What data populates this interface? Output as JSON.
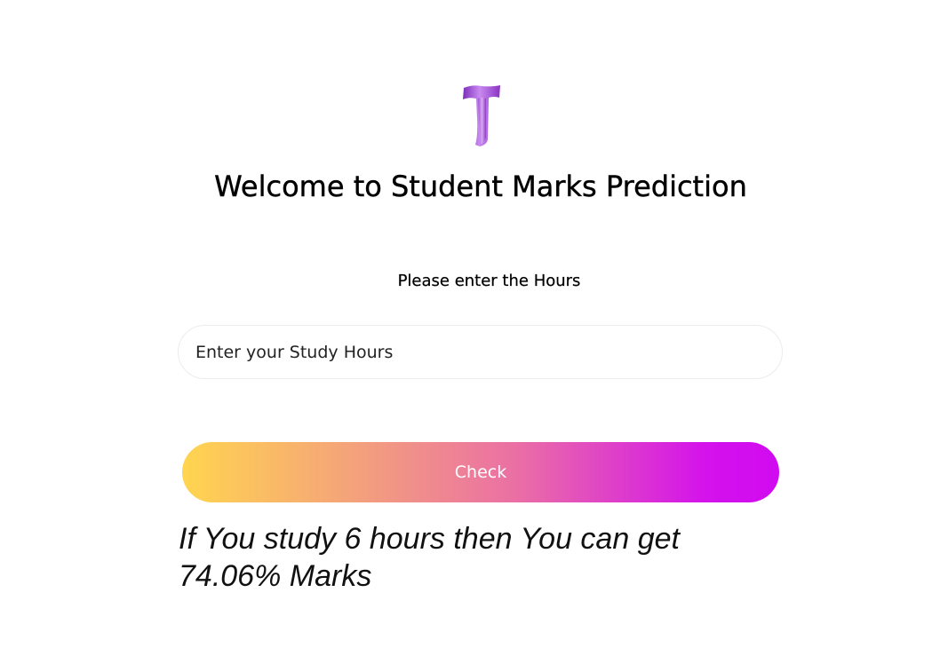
{
  "logo": {
    "letter": "T",
    "icon": "purple-t-logo-icon",
    "color": "#a24bd6"
  },
  "header": {
    "title": "Welcome to Student Marks Prediction"
  },
  "form": {
    "label": "Please enter the Hours",
    "input": {
      "placeholder": "Enter your Study Hours",
      "value": ""
    },
    "submit_label": "Check",
    "gradient_colors": [
      "#ffd54f",
      "#f4a37a",
      "#ea6fa5",
      "#d312ec"
    ]
  },
  "result": {
    "text": "If You study 6 hours then You can get 74.06% Marks"
  }
}
